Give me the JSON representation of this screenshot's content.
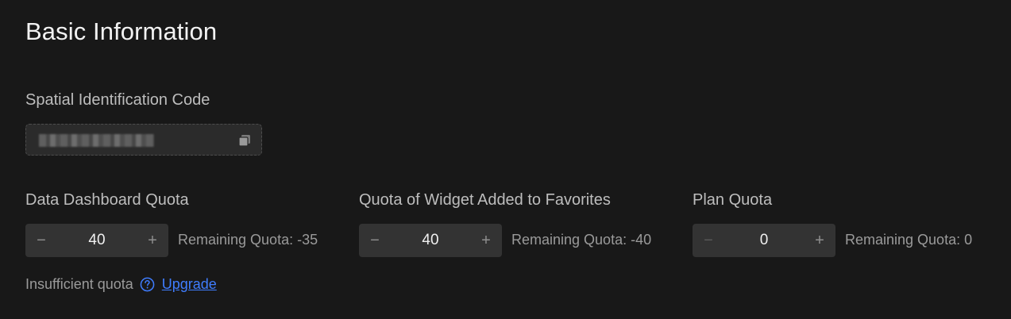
{
  "section": {
    "title": "Basic Information"
  },
  "spatial_code": {
    "label": "Spatial Identification Code",
    "copy_icon": "copy-icon"
  },
  "quotas": [
    {
      "label": "Data Dashboard Quota",
      "value": "40",
      "remaining": "Remaining Quota: -35",
      "minus_icon": "minus",
      "plus_icon": "plus"
    },
    {
      "label": "Quota of Widget Added to Favorites",
      "value": "40",
      "remaining": "Remaining Quota: -40",
      "minus_icon": "minus",
      "plus_icon": "plus"
    },
    {
      "label": "Plan Quota",
      "value": "0",
      "remaining": "Remaining Quota: 0",
      "minus_icon": "minus",
      "plus_icon": "plus"
    }
  ],
  "footer": {
    "insufficient_text": "Insufficient quota",
    "help_icon": "question-circle-icon",
    "upgrade_label": "Upgrade"
  },
  "colors": {
    "background": "#181818",
    "link": "#3f7dff",
    "stepper_bg": "#333333"
  }
}
